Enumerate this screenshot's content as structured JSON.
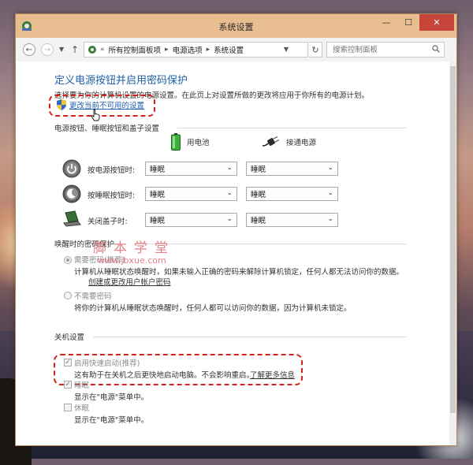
{
  "window": {
    "title": "系统设置"
  },
  "window_controls": {
    "minimize": "—",
    "maximize": "☐",
    "close": "✕"
  },
  "address": {
    "back": "←",
    "forward": "→",
    "up": "↑",
    "root_marker": "«",
    "crumbs": [
      "所有控制面板项",
      "电源选项",
      "系统设置"
    ],
    "refresh": "↻",
    "search_placeholder": "搜索控制面板"
  },
  "main": {
    "heading": "定义电源按钮并启用密码保护",
    "description": "选择要为你的计算机设置的电源设置。在此页上对设置所做的更改将应用于你所有的电源计划。",
    "change_link": "更改当前不可用的设置"
  },
  "power_buttons": {
    "section_title": "电源按钮、睡眠按钮和盖子设置",
    "col_battery": "用电池",
    "col_plugged": "接通电源",
    "rows": [
      {
        "label": "按电源按钮时:",
        "battery": "睡眠",
        "plugged": "睡眠"
      },
      {
        "label": "按睡眠按钮时:",
        "battery": "睡眠",
        "plugged": "睡眠"
      },
      {
        "label": "关闭盖子时:",
        "battery": "睡眠",
        "plugged": "睡眠"
      }
    ]
  },
  "password": {
    "section_title": "唤醒时的密码保护",
    "require": {
      "label": "需要密码(推荐)",
      "desc": "计算机从睡眠状态唤醒时，如果未输入正确的密码来解除计算机锁定，任何人都无法访问你的数据。",
      "link": "创建或更改用户帐户密码"
    },
    "no_require": {
      "label": "不需要密码",
      "desc": "将你的计算机从睡眠状态唤醒时，任何人都可以访问你的数据，因为计算机未锁定。"
    }
  },
  "shutdown": {
    "section_title": "关机设置",
    "items": [
      {
        "label": "启用快速启动(推荐)",
        "checked": true,
        "desc": "这有助于在关机之后更快地启动电脑。不会影响重启。",
        "link": "了解更多信息"
      },
      {
        "label": "睡眠",
        "checked": true,
        "desc": "显示在\"电源\"菜单中。"
      },
      {
        "label": "休眠",
        "checked": false,
        "desc": "显示在\"电源\"菜单中。"
      }
    ]
  },
  "watermark": {
    "line1": "脚本学堂",
    "line2": "www.jbxue.com"
  },
  "colors": {
    "heading": "#1e5fa6",
    "link": "#1d5fb4",
    "highlight": "#d8201a",
    "titlebar": "#e8bd8f"
  }
}
